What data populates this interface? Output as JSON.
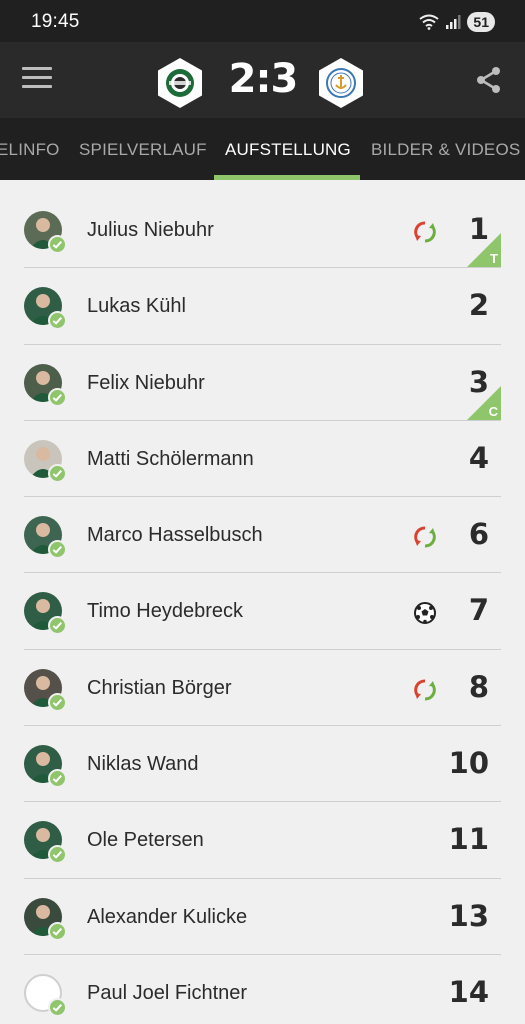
{
  "status_bar": {
    "time": "19:45",
    "battery": "51"
  },
  "header": {
    "score": "2:3"
  },
  "tabs": [
    {
      "label": "ELINFO",
      "active": false
    },
    {
      "label": "SPIELVERLAUF",
      "active": false
    },
    {
      "label": "AUFSTELLUNG",
      "active": true
    },
    {
      "label": "BILDER & VIDEOS",
      "active": false
    }
  ],
  "players": [
    {
      "name": "Julius Niebuhr",
      "number": "1",
      "event": "substitution-icon",
      "badge": "T",
      "avatar_color": "#5b6b55"
    },
    {
      "name": "Lukas Kühl",
      "number": "2",
      "event": "",
      "badge": "",
      "avatar_color": "#2f5d45"
    },
    {
      "name": "Felix Niebuhr",
      "number": "3",
      "event": "",
      "badge": "C",
      "avatar_color": "#4d5e4b"
    },
    {
      "name": "Matti Schölermann",
      "number": "4",
      "event": "",
      "badge": "",
      "avatar_color": "#c9c5bd"
    },
    {
      "name": "Marco Hasselbusch",
      "number": "6",
      "event": "substitution-icon",
      "badge": "",
      "avatar_color": "#3e6551"
    },
    {
      "name": "Timo Heydebreck",
      "number": "7",
      "event": "ball-icon",
      "badge": "",
      "avatar_color": "#2f5d45"
    },
    {
      "name": "Christian Börger",
      "number": "8",
      "event": "substitution-icon",
      "badge": "",
      "avatar_color": "#555049"
    },
    {
      "name": "Niklas Wand",
      "number": "10",
      "event": "",
      "badge": "",
      "avatar_color": "#2f5d45"
    },
    {
      "name": "Ole Petersen",
      "number": "11",
      "event": "",
      "badge": "",
      "avatar_color": "#2f5d45"
    },
    {
      "name": "Alexander Kulicke",
      "number": "13",
      "event": "",
      "badge": "",
      "avatar_color": "#3a4a3d"
    },
    {
      "name": "Paul Joel Fichtner",
      "number": "14",
      "event": "",
      "badge": "",
      "avatar_color": "#ffffff"
    }
  ],
  "colors": {
    "accent": "#8fc56b",
    "substitution_red": "#d9432f",
    "substitution_green": "#6cae3f"
  }
}
